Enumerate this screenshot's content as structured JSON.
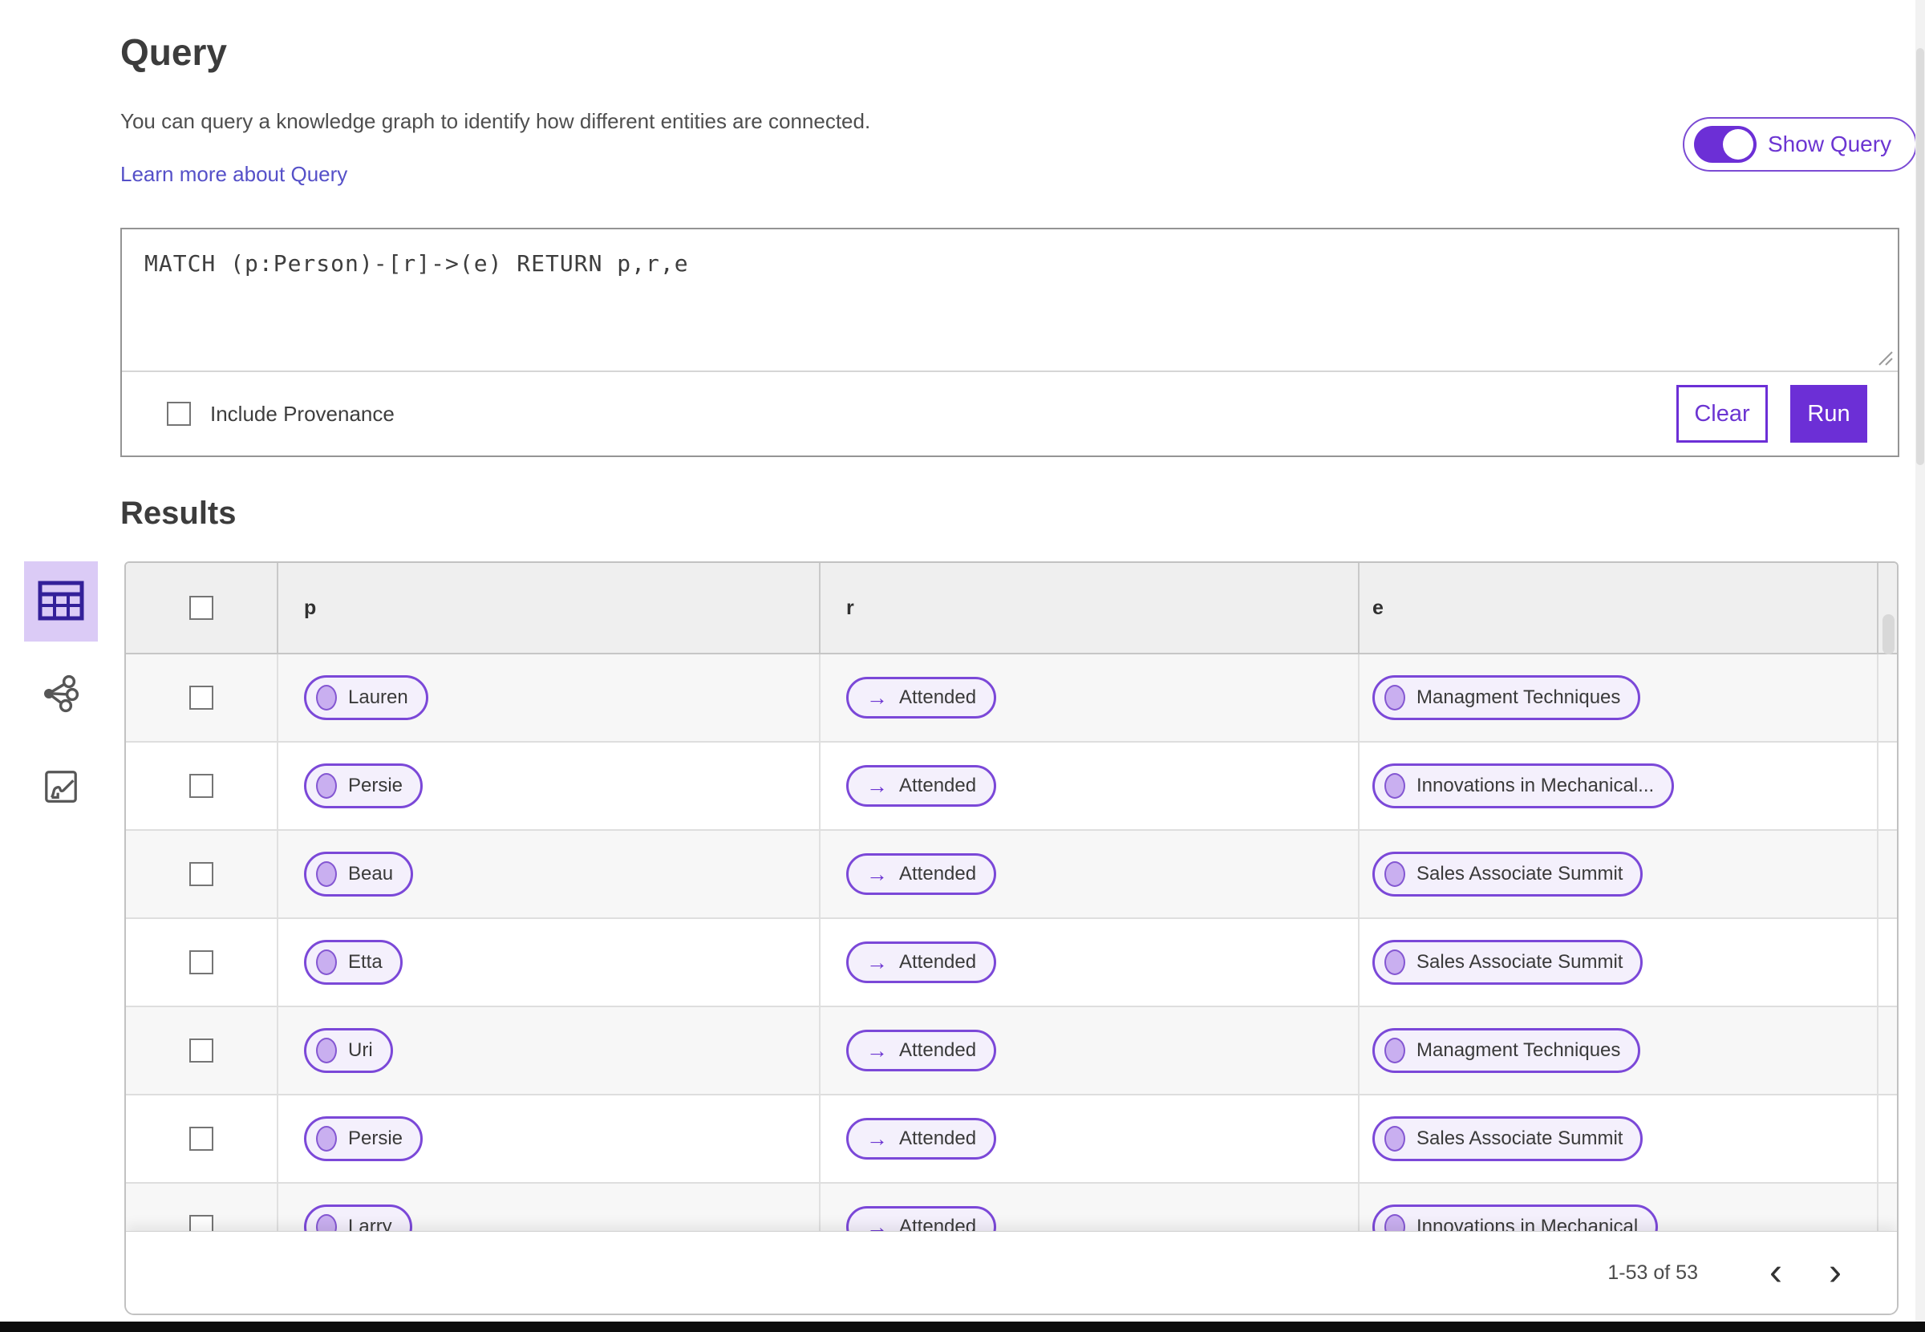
{
  "header": {
    "title": "Query",
    "description": "You can query a knowledge graph to identify how different entities are connected.",
    "learn_more": "Learn more about Query",
    "show_query_label": "Show Query",
    "show_query_on": true
  },
  "query_panel": {
    "query_text": "MATCH (p:Person)-[r]->(e) RETURN p,r,e",
    "include_provenance_label": "Include Provenance",
    "include_provenance_checked": false,
    "clear_label": "Clear",
    "run_label": "Run"
  },
  "results": {
    "title": "Results",
    "views": [
      {
        "icon": "table-view-icon",
        "selected": true
      },
      {
        "icon": "graph-view-icon",
        "selected": false
      },
      {
        "icon": "map-view-icon",
        "selected": false
      }
    ],
    "columns": [
      "p",
      "r",
      "e"
    ],
    "relationship_arrow": "→",
    "rows": [
      {
        "p": "Lauren",
        "r": "Attended",
        "e": "Managment Techniques"
      },
      {
        "p": "Persie",
        "r": "Attended",
        "e": "Innovations in Mechanical..."
      },
      {
        "p": "Beau",
        "r": "Attended",
        "e": "Sales Associate Summit"
      },
      {
        "p": "Etta",
        "r": "Attended",
        "e": "Sales Associate Summit"
      },
      {
        "p": "Uri",
        "r": "Attended",
        "e": "Managment Techniques"
      },
      {
        "p": "Persie",
        "r": "Attended",
        "e": "Sales Associate Summit"
      },
      {
        "p": "Larry",
        "r": "Attended",
        "e": "Innovations in Mechanical"
      }
    ],
    "pagination": {
      "range_label": "1-53 of 53",
      "prev_icon": "‹",
      "next_icon": "›"
    }
  },
  "colors": {
    "accent_purple": "#6c2fd6",
    "pill_border": "#7b48d8",
    "pill_background": "#f4f0fc",
    "node_fill": "#c9aff0",
    "selected_view_background": "#dbcbf6",
    "table_header_background": "#efefef",
    "alt_row_background": "#f7f7f7",
    "link_color": "#5550c8"
  }
}
